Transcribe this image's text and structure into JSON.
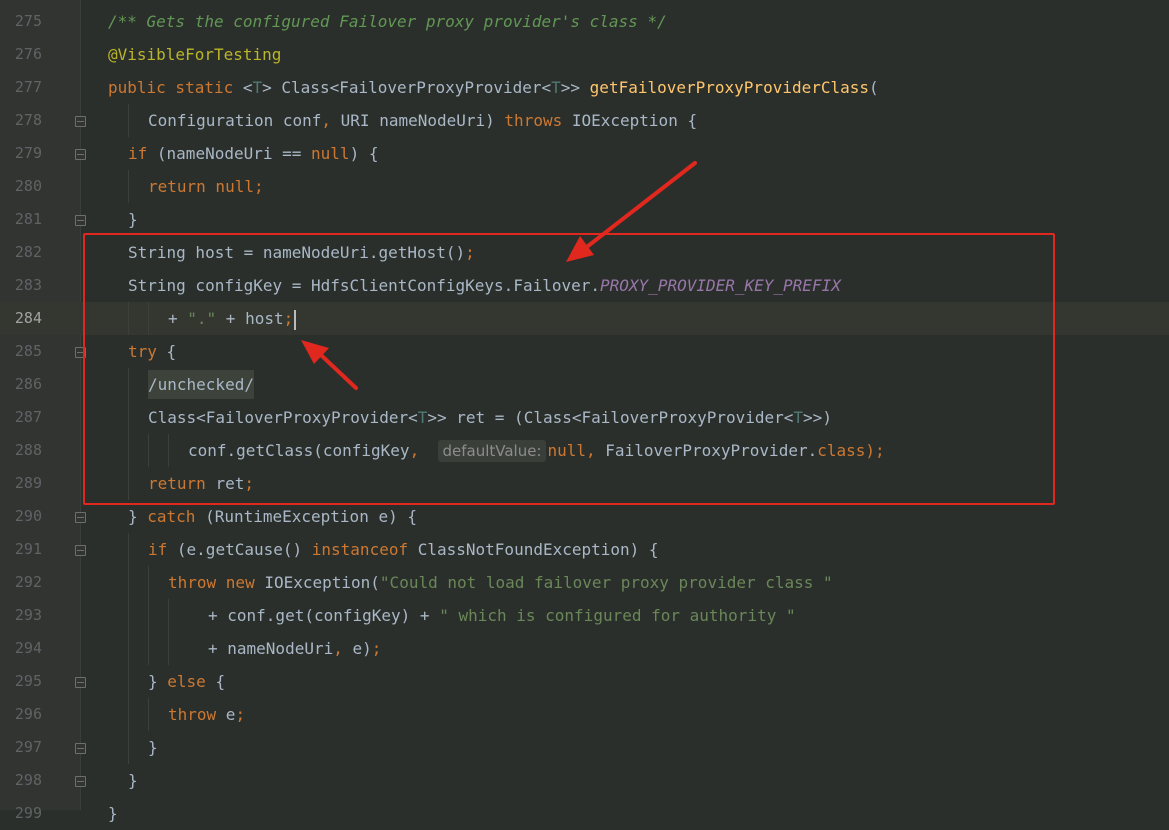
{
  "editor": {
    "lines": [
      {
        "n": "275",
        "fold": false,
        "indent": 108,
        "tokens": [
          {
            "t": "/** Gets the configured Failover proxy provider's class */",
            "c": "cm"
          }
        ]
      },
      {
        "n": "276",
        "fold": false,
        "indent": 108,
        "tokens": [
          {
            "t": "@VisibleForTesting",
            "c": "an"
          }
        ]
      },
      {
        "n": "277",
        "fold": false,
        "indent": 108,
        "tokens": [
          {
            "t": "public static ",
            "c": "kw"
          },
          {
            "t": "<",
            "c": ""
          },
          {
            "t": "T",
            "c": "tp"
          },
          {
            "t": "> Class<FailoverProxyProvider<",
            "c": ""
          },
          {
            "t": "T",
            "c": "tp"
          },
          {
            "t": ">> ",
            "c": ""
          },
          {
            "t": "getFailoverProxyProviderClass",
            "c": "fn"
          },
          {
            "t": "(",
            "c": ""
          }
        ]
      },
      {
        "n": "278",
        "fold": true,
        "indent": 148,
        "tokens": [
          {
            "t": "Configuration conf",
            "c": ""
          },
          {
            "t": ", ",
            "c": "kw"
          },
          {
            "t": "URI nameNodeUri) ",
            "c": ""
          },
          {
            "t": "throws ",
            "c": "kw"
          },
          {
            "t": "IOException {",
            "c": ""
          }
        ]
      },
      {
        "n": "279",
        "fold": true,
        "indent": 128,
        "tokens": [
          {
            "t": "if ",
            "c": "kw"
          },
          {
            "t": "(nameNodeUri == ",
            "c": ""
          },
          {
            "t": "null",
            "c": "kw"
          },
          {
            "t": ") {",
            "c": ""
          }
        ]
      },
      {
        "n": "280",
        "fold": false,
        "indent": 148,
        "tokens": [
          {
            "t": "return null;",
            "c": "kw"
          }
        ]
      },
      {
        "n": "281",
        "fold": true,
        "indent": 128,
        "tokens": [
          {
            "t": "}",
            "c": ""
          }
        ]
      },
      {
        "n": "282",
        "fold": false,
        "indent": 128,
        "tokens": [
          {
            "t": "String host = nameNodeUri.getHost()",
            "c": ""
          },
          {
            "t": ";",
            "c": "kw"
          }
        ]
      },
      {
        "n": "283",
        "fold": false,
        "indent": 128,
        "tokens": [
          {
            "t": "String configKey = HdfsClientConfigKeys.Failover.",
            "c": ""
          },
          {
            "t": "PROXY_PROVIDER_KEY_PREFIX",
            "c": "cs"
          }
        ]
      },
      {
        "n": "284",
        "fold": false,
        "indent": 168,
        "current": true,
        "tokens": [
          {
            "t": "+ ",
            "c": ""
          },
          {
            "t": "\".\"",
            "c": "st"
          },
          {
            "t": " + host",
            "c": ""
          },
          {
            "t": ";",
            "c": "kw"
          },
          {
            "t": "",
            "c": "caret"
          }
        ]
      },
      {
        "n": "285",
        "fold": true,
        "indent": 128,
        "tokens": [
          {
            "t": "try ",
            "c": "kw"
          },
          {
            "t": "{",
            "c": ""
          }
        ]
      },
      {
        "n": "286",
        "fold": false,
        "indent": 148,
        "tokens": [
          {
            "t": "/unchecked/",
            "c": "unchk"
          }
        ]
      },
      {
        "n": "287",
        "fold": false,
        "indent": 148,
        "tokens": [
          {
            "t": "Class<FailoverProxyProvider<",
            "c": ""
          },
          {
            "t": "T",
            "c": "tp"
          },
          {
            "t": ">> ret = (Class<FailoverProxyProvider<",
            "c": ""
          },
          {
            "t": "T",
            "c": "tp"
          },
          {
            "t": ">>)",
            "c": ""
          }
        ]
      },
      {
        "n": "288",
        "fold": false,
        "indent": 188,
        "tokens": [
          {
            "t": "conf.getClass(configKey",
            "c": ""
          },
          {
            "t": ",  ",
            "c": "kw"
          },
          {
            "t": "defaultValue:",
            "c": "hint"
          },
          {
            "t": "null",
            "c": "kw"
          },
          {
            "t": ", ",
            "c": "kw"
          },
          {
            "t": "FailoverProxyProvider.",
            "c": ""
          },
          {
            "t": "class",
            "c": "kw"
          },
          {
            "t": ");",
            "c": "kw"
          }
        ]
      },
      {
        "n": "289",
        "fold": false,
        "indent": 148,
        "tokens": [
          {
            "t": "return ",
            "c": "kw"
          },
          {
            "t": "ret",
            "c": ""
          },
          {
            "t": ";",
            "c": "kw"
          }
        ]
      },
      {
        "n": "290",
        "fold": true,
        "indent": 128,
        "tokens": [
          {
            "t": "} ",
            "c": ""
          },
          {
            "t": "catch ",
            "c": "kw"
          },
          {
            "t": "(RuntimeException e) {",
            "c": ""
          }
        ]
      },
      {
        "n": "291",
        "fold": true,
        "indent": 148,
        "tokens": [
          {
            "t": "if ",
            "c": "kw"
          },
          {
            "t": "(e.getCause() ",
            "c": ""
          },
          {
            "t": "instanceof ",
            "c": "kw"
          },
          {
            "t": "ClassNotFoundException) {",
            "c": ""
          }
        ]
      },
      {
        "n": "292",
        "fold": false,
        "indent": 168,
        "tokens": [
          {
            "t": "throw new ",
            "c": "kw"
          },
          {
            "t": "IOException(",
            "c": ""
          },
          {
            "t": "\"Could not load failover proxy provider class \"",
            "c": "st"
          }
        ]
      },
      {
        "n": "293",
        "fold": false,
        "indent": 208,
        "tokens": [
          {
            "t": "+ conf.get(configKey) + ",
            "c": ""
          },
          {
            "t": "\" which is configured for authority \"",
            "c": "st"
          }
        ]
      },
      {
        "n": "294",
        "fold": false,
        "indent": 208,
        "tokens": [
          {
            "t": "+ nameNodeUri",
            "c": ""
          },
          {
            "t": ", ",
            "c": "kw"
          },
          {
            "t": "e)",
            "c": ""
          },
          {
            "t": ";",
            "c": "kw"
          }
        ]
      },
      {
        "n": "295",
        "fold": true,
        "indent": 148,
        "tokens": [
          {
            "t": "} ",
            "c": ""
          },
          {
            "t": "else ",
            "c": "kw"
          },
          {
            "t": "{",
            "c": ""
          }
        ]
      },
      {
        "n": "296",
        "fold": false,
        "indent": 168,
        "tokens": [
          {
            "t": "throw ",
            "c": "kw"
          },
          {
            "t": "e",
            "c": ""
          },
          {
            "t": ";",
            "c": "kw"
          }
        ]
      },
      {
        "n": "297",
        "fold": true,
        "indent": 148,
        "tokens": [
          {
            "t": "}",
            "c": ""
          }
        ]
      },
      {
        "n": "298",
        "fold": true,
        "indent": 128,
        "tokens": [
          {
            "t": "}",
            "c": ""
          }
        ]
      },
      {
        "n": "299",
        "fold": false,
        "indent": 108,
        "tokens": [
          {
            "t": "}",
            "c": ""
          }
        ]
      }
    ]
  },
  "annotation": {
    "box_color": "#e0281e",
    "arrow_color": "#e0281e"
  }
}
